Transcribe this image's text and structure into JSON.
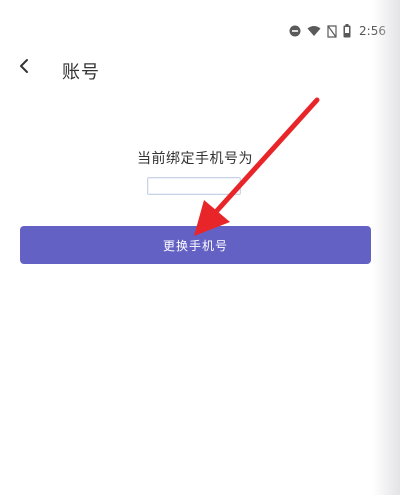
{
  "status_bar": {
    "time": "2:56",
    "icons": [
      "dnd-icon",
      "wifi-icon",
      "no-signal-icon",
      "battery-icon"
    ]
  },
  "nav": {
    "title": "账号",
    "back_icon": "chevron-left-icon"
  },
  "main": {
    "bind_label": "当前绑定手机号为",
    "phone_value": "",
    "change_button_label": "更换手机号"
  },
  "colors": {
    "accent": "#6461c4",
    "annotation_arrow": "#e8262a"
  }
}
